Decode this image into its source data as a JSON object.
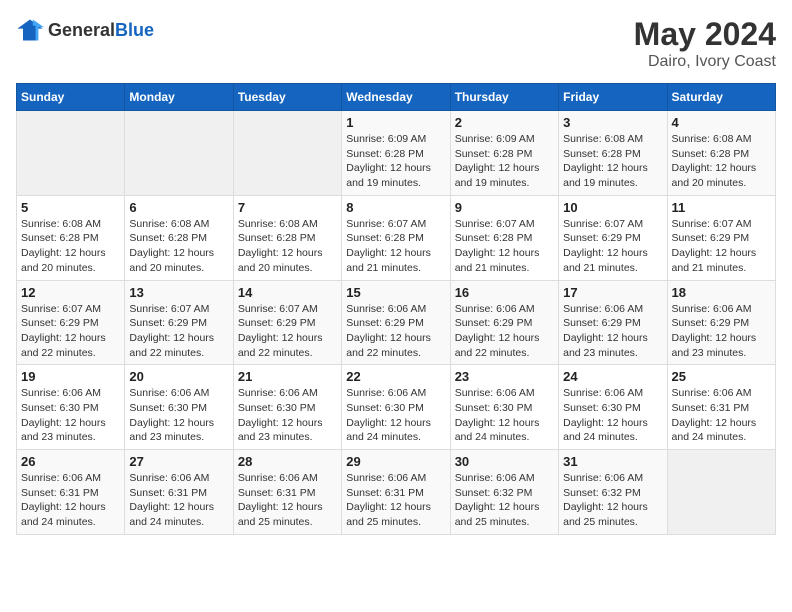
{
  "logo": {
    "general": "General",
    "blue": "Blue"
  },
  "title": {
    "month_year": "May 2024",
    "location": "Dairo, Ivory Coast"
  },
  "weekdays": [
    "Sunday",
    "Monday",
    "Tuesday",
    "Wednesday",
    "Thursday",
    "Friday",
    "Saturday"
  ],
  "weeks": [
    [
      {
        "day": null
      },
      {
        "day": null
      },
      {
        "day": null
      },
      {
        "day": 1,
        "sunrise": "6:09 AM",
        "sunset": "6:28 PM",
        "daylight": "12 hours and 19 minutes."
      },
      {
        "day": 2,
        "sunrise": "6:09 AM",
        "sunset": "6:28 PM",
        "daylight": "12 hours and 19 minutes."
      },
      {
        "day": 3,
        "sunrise": "6:08 AM",
        "sunset": "6:28 PM",
        "daylight": "12 hours and 19 minutes."
      },
      {
        "day": 4,
        "sunrise": "6:08 AM",
        "sunset": "6:28 PM",
        "daylight": "12 hours and 20 minutes."
      }
    ],
    [
      {
        "day": 5,
        "sunrise": "6:08 AM",
        "sunset": "6:28 PM",
        "daylight": "12 hours and 20 minutes."
      },
      {
        "day": 6,
        "sunrise": "6:08 AM",
        "sunset": "6:28 PM",
        "daylight": "12 hours and 20 minutes."
      },
      {
        "day": 7,
        "sunrise": "6:08 AM",
        "sunset": "6:28 PM",
        "daylight": "12 hours and 20 minutes."
      },
      {
        "day": 8,
        "sunrise": "6:07 AM",
        "sunset": "6:28 PM",
        "daylight": "12 hours and 21 minutes."
      },
      {
        "day": 9,
        "sunrise": "6:07 AM",
        "sunset": "6:28 PM",
        "daylight": "12 hours and 21 minutes."
      },
      {
        "day": 10,
        "sunrise": "6:07 AM",
        "sunset": "6:29 PM",
        "daylight": "12 hours and 21 minutes."
      },
      {
        "day": 11,
        "sunrise": "6:07 AM",
        "sunset": "6:29 PM",
        "daylight": "12 hours and 21 minutes."
      }
    ],
    [
      {
        "day": 12,
        "sunrise": "6:07 AM",
        "sunset": "6:29 PM",
        "daylight": "12 hours and 22 minutes."
      },
      {
        "day": 13,
        "sunrise": "6:07 AM",
        "sunset": "6:29 PM",
        "daylight": "12 hours and 22 minutes."
      },
      {
        "day": 14,
        "sunrise": "6:07 AM",
        "sunset": "6:29 PM",
        "daylight": "12 hours and 22 minutes."
      },
      {
        "day": 15,
        "sunrise": "6:06 AM",
        "sunset": "6:29 PM",
        "daylight": "12 hours and 22 minutes."
      },
      {
        "day": 16,
        "sunrise": "6:06 AM",
        "sunset": "6:29 PM",
        "daylight": "12 hours and 22 minutes."
      },
      {
        "day": 17,
        "sunrise": "6:06 AM",
        "sunset": "6:29 PM",
        "daylight": "12 hours and 23 minutes."
      },
      {
        "day": 18,
        "sunrise": "6:06 AM",
        "sunset": "6:29 PM",
        "daylight": "12 hours and 23 minutes."
      }
    ],
    [
      {
        "day": 19,
        "sunrise": "6:06 AM",
        "sunset": "6:30 PM",
        "daylight": "12 hours and 23 minutes."
      },
      {
        "day": 20,
        "sunrise": "6:06 AM",
        "sunset": "6:30 PM",
        "daylight": "12 hours and 23 minutes."
      },
      {
        "day": 21,
        "sunrise": "6:06 AM",
        "sunset": "6:30 PM",
        "daylight": "12 hours and 23 minutes."
      },
      {
        "day": 22,
        "sunrise": "6:06 AM",
        "sunset": "6:30 PM",
        "daylight": "12 hours and 24 minutes."
      },
      {
        "day": 23,
        "sunrise": "6:06 AM",
        "sunset": "6:30 PM",
        "daylight": "12 hours and 24 minutes."
      },
      {
        "day": 24,
        "sunrise": "6:06 AM",
        "sunset": "6:30 PM",
        "daylight": "12 hours and 24 minutes."
      },
      {
        "day": 25,
        "sunrise": "6:06 AM",
        "sunset": "6:31 PM",
        "daylight": "12 hours and 24 minutes."
      }
    ],
    [
      {
        "day": 26,
        "sunrise": "6:06 AM",
        "sunset": "6:31 PM",
        "daylight": "12 hours and 24 minutes."
      },
      {
        "day": 27,
        "sunrise": "6:06 AM",
        "sunset": "6:31 PM",
        "daylight": "12 hours and 24 minutes."
      },
      {
        "day": 28,
        "sunrise": "6:06 AM",
        "sunset": "6:31 PM",
        "daylight": "12 hours and 25 minutes."
      },
      {
        "day": 29,
        "sunrise": "6:06 AM",
        "sunset": "6:31 PM",
        "daylight": "12 hours and 25 minutes."
      },
      {
        "day": 30,
        "sunrise": "6:06 AM",
        "sunset": "6:32 PM",
        "daylight": "12 hours and 25 minutes."
      },
      {
        "day": 31,
        "sunrise": "6:06 AM",
        "sunset": "6:32 PM",
        "daylight": "12 hours and 25 minutes."
      },
      {
        "day": null
      }
    ]
  ],
  "labels": {
    "sunrise": "Sunrise:",
    "sunset": "Sunset:",
    "daylight": "Daylight:"
  }
}
